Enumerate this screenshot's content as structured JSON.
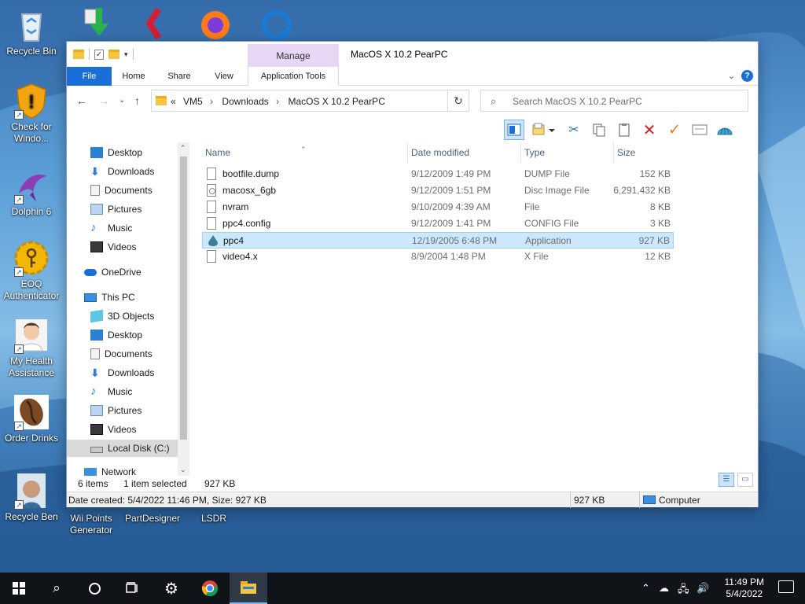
{
  "desktop": {
    "icons": [
      {
        "label": "Recycle Bin"
      },
      {
        "label": "Check for Windo..."
      },
      {
        "label": "Dolphin 6"
      },
      {
        "label": "EOQ Authenticator"
      },
      {
        "label": "My Health Assistance"
      },
      {
        "label": "Order Drinks"
      },
      {
        "label": "Recycle Ben"
      },
      {
        "label": "Wii Points Generator"
      },
      {
        "label": "PartDesigner"
      },
      {
        "label": "LSDR"
      }
    ]
  },
  "window": {
    "title": "MacOS X 10.2 PearPC",
    "manage_tab": "Manage",
    "ribbon_tabs": {
      "file": "File",
      "home": "Home",
      "share": "Share",
      "view": "View",
      "app_tools": "Application Tools"
    },
    "address": {
      "overflow": "«",
      "crumbs": [
        "VM5",
        "Downloads",
        "MacOS X 10.2 PearPC"
      ]
    },
    "search_placeholder": "Search MacOS X 10.2 PearPC",
    "nav": {
      "quick_access": [
        {
          "label": "Desktop"
        },
        {
          "label": "Downloads"
        },
        {
          "label": "Documents"
        },
        {
          "label": "Pictures"
        },
        {
          "label": "Music"
        },
        {
          "label": "Videos"
        }
      ],
      "onedrive": "OneDrive",
      "this_pc": "This PC",
      "this_pc_items": [
        {
          "label": "3D Objects"
        },
        {
          "label": "Desktop"
        },
        {
          "label": "Documents"
        },
        {
          "label": "Downloads"
        },
        {
          "label": "Music"
        },
        {
          "label": "Pictures"
        },
        {
          "label": "Videos"
        },
        {
          "label": "Local Disk (C:)"
        }
      ],
      "network": "Network"
    },
    "columns": {
      "name": "Name",
      "date": "Date modified",
      "type": "Type",
      "size": "Size"
    },
    "files": [
      {
        "name": "bootfile.dump",
        "date": "9/12/2009 1:49 PM",
        "type": "DUMP File",
        "size": "152 KB"
      },
      {
        "name": "macosx_6gb",
        "date": "9/12/2009 1:51 PM",
        "type": "Disc Image File",
        "size": "6,291,432 KB"
      },
      {
        "name": "nvram",
        "date": "9/10/2009 4:39 AM",
        "type": "File",
        "size": "8 KB"
      },
      {
        "name": "ppc4.config",
        "date": "9/12/2009 1:41 PM",
        "type": "CONFIG File",
        "size": "3 KB"
      },
      {
        "name": "ppc4",
        "date": "12/19/2005 6:48 PM",
        "type": "Application",
        "size": "927 KB"
      },
      {
        "name": "video4.x",
        "date": "8/9/2004 1:48 PM",
        "type": "X File",
        "size": "12 KB"
      }
    ],
    "status": {
      "count": "6 items",
      "selected": "1 item selected",
      "selected_size": "927 KB"
    },
    "details": {
      "info": "Date created: 5/4/2022 11:46 PM, Size: 927 KB",
      "size": "927 KB",
      "location": "Computer"
    }
  },
  "taskbar": {
    "time": "11:49 PM",
    "date": "5/4/2022"
  }
}
